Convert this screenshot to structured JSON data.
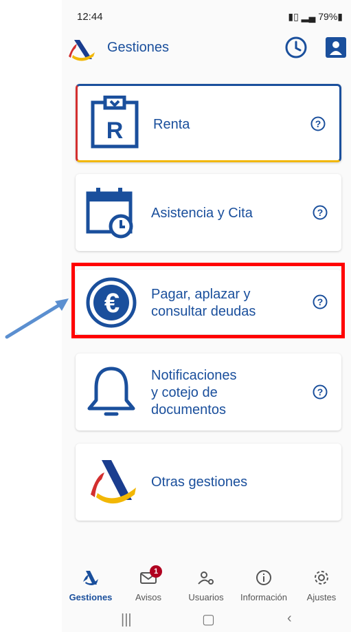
{
  "status_bar": {
    "time": "12:44",
    "right": "79%"
  },
  "header": {
    "title": "Gestiones"
  },
  "cards": [
    {
      "label_lines": [
        "Renta"
      ]
    },
    {
      "label_lines": [
        "Asistencia y Cita"
      ]
    },
    {
      "label_lines": [
        "Pagar, aplazar y",
        "consultar deudas"
      ]
    },
    {
      "label_lines": [
        "Notificaciones",
        "y cotejo de",
        "documentos"
      ]
    },
    {
      "label_lines": [
        "Otras gestiones"
      ]
    }
  ],
  "bottom_nav": [
    {
      "label": "Gestiones",
      "active": true
    },
    {
      "label": "Avisos",
      "badge": "1"
    },
    {
      "label": "Usuarios"
    },
    {
      "label": "Información"
    },
    {
      "label": "Ajustes"
    }
  ],
  "colors": {
    "brand_blue": "#1a4f9c",
    "highlight_red": "#ff0000",
    "arrow_blue": "#5b8fd0"
  }
}
